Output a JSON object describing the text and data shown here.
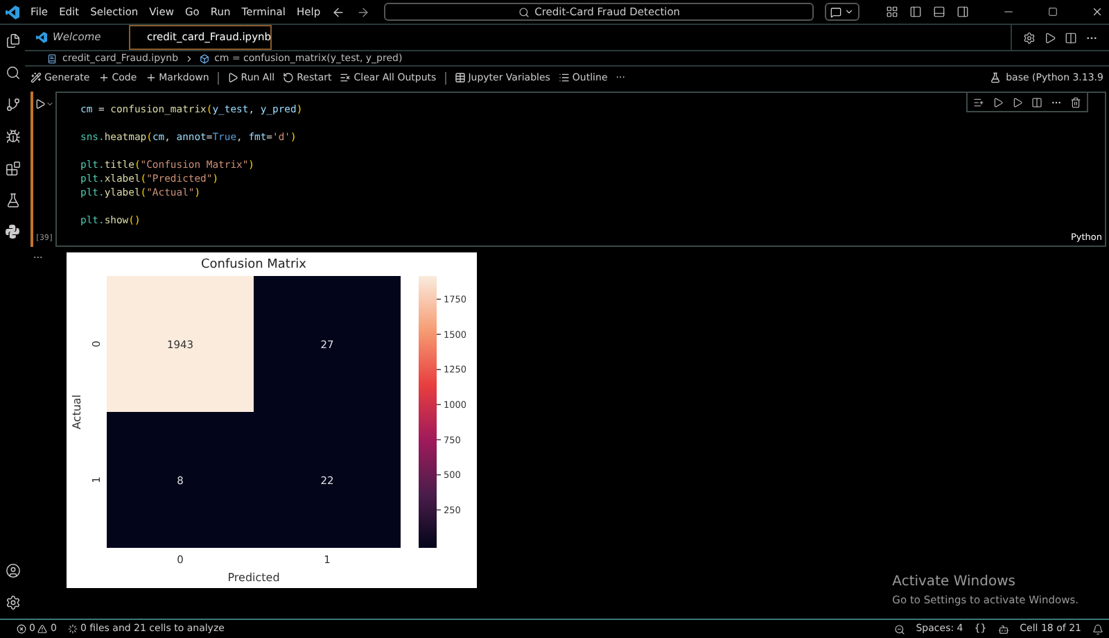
{
  "menu": [
    "File",
    "Edit",
    "Selection",
    "View",
    "Go",
    "Run",
    "Terminal",
    "Help"
  ],
  "search": {
    "value": "Credit-Card Fraud Detection"
  },
  "tabs": [
    {
      "label": "Welcome",
      "selected": false,
      "kind": "welcome"
    },
    {
      "label": "credit_card_Fraud.ipynb",
      "selected": true,
      "kind": "notebook"
    }
  ],
  "breadcrumb": {
    "file": "credit_card_Fraud.ipynb",
    "symbol": "cm = confusion_matrix(y_test, y_pred)"
  },
  "toolbar": {
    "groups": [
      [
        "Generate",
        "Code",
        "Markdown"
      ],
      [
        "Run All",
        "Restart",
        "Clear All Outputs"
      ],
      [
        "Jupyter Variables",
        "Outline"
      ]
    ],
    "more": "···",
    "kernel": "base (Python 3.13.9"
  },
  "cell": {
    "execution_count": "[39]",
    "language": "Python",
    "blocks": [
      [
        [
          {
            "t": "cm",
            "kind": "var"
          },
          {
            "t": " = ",
            "kind": "op"
          },
          {
            "t": "confusion_matrix",
            "kind": "fn"
          },
          {
            "t": "(",
            "kind": "br"
          },
          {
            "t": "y_test",
            "kind": "var"
          },
          {
            "t": ", ",
            "kind": "op"
          },
          {
            "t": "y_pred",
            "kind": "var"
          },
          {
            "t": ")",
            "kind": "br"
          }
        ]
      ],
      [
        [
          {
            "t": "sns.",
            "kind": "mod"
          },
          {
            "t": "heatmap",
            "kind": "fn"
          },
          {
            "t": "(",
            "kind": "br"
          },
          {
            "t": "cm",
            "kind": "var"
          },
          {
            "t": ", ",
            "kind": "op"
          },
          {
            "t": "annot",
            "kind": "var"
          },
          {
            "t": "=",
            "kind": "op"
          },
          {
            "t": "True",
            "kind": "kw"
          },
          {
            "t": ", ",
            "kind": "op"
          },
          {
            "t": "fmt",
            "kind": "var"
          },
          {
            "t": "=",
            "kind": "op"
          },
          {
            "t": "'d'",
            "kind": "str"
          },
          {
            "t": ")",
            "kind": "br"
          }
        ]
      ],
      [
        [
          {
            "t": "plt.",
            "kind": "mod"
          },
          {
            "t": "title",
            "kind": "fn"
          },
          {
            "t": "(",
            "kind": "br"
          },
          {
            "t": "\"Confusion Matrix\"",
            "kind": "str"
          },
          {
            "t": ")",
            "kind": "br"
          }
        ],
        [
          {
            "t": "plt.",
            "kind": "mod"
          },
          {
            "t": "xlabel",
            "kind": "fn"
          },
          {
            "t": "(",
            "kind": "br"
          },
          {
            "t": "\"Predicted\"",
            "kind": "str"
          },
          {
            "t": ")",
            "kind": "br"
          }
        ],
        [
          {
            "t": "plt.",
            "kind": "mod"
          },
          {
            "t": "ylabel",
            "kind": "fn"
          },
          {
            "t": "(",
            "kind": "br"
          },
          {
            "t": "\"Actual\"",
            "kind": "str"
          },
          {
            "t": ")",
            "kind": "br"
          }
        ]
      ],
      [
        [
          {
            "t": "plt.",
            "kind": "mod"
          },
          {
            "t": "show",
            "kind": "fn"
          },
          {
            "t": "()",
            "kind": "br"
          }
        ]
      ]
    ]
  },
  "output": {
    "marker": "...",
    "figure": {
      "title": "Confusion Matrix",
      "xlabel": "Predicted",
      "ylabel": "Actual",
      "x_ticks": [
        "0",
        "1"
      ],
      "y_ticks": [
        "0",
        "1"
      ],
      "cells": [
        [
          {
            "text": "1943",
            "color": "#faebdd"
          },
          {
            "text": "27",
            "color": "#03051a"
          }
        ],
        [
          {
            "text": "8",
            "color": "#03051a"
          },
          {
            "text": "22",
            "color": "#03051a"
          }
        ]
      ],
      "colorbar_ticks": [
        "1750",
        "1500",
        "1250",
        "1000",
        "750",
        "500",
        "250"
      ]
    }
  },
  "activation": {
    "title": "Activate Windows",
    "text": "Go to Settings to activate Windows."
  },
  "status": {
    "errors": "0",
    "warnings": "0",
    "analysis": "0 files and 21 cells to analyze",
    "spaces": "Spaces: 4",
    "braces": "{}",
    "cell": "Cell 18 of 21"
  }
}
